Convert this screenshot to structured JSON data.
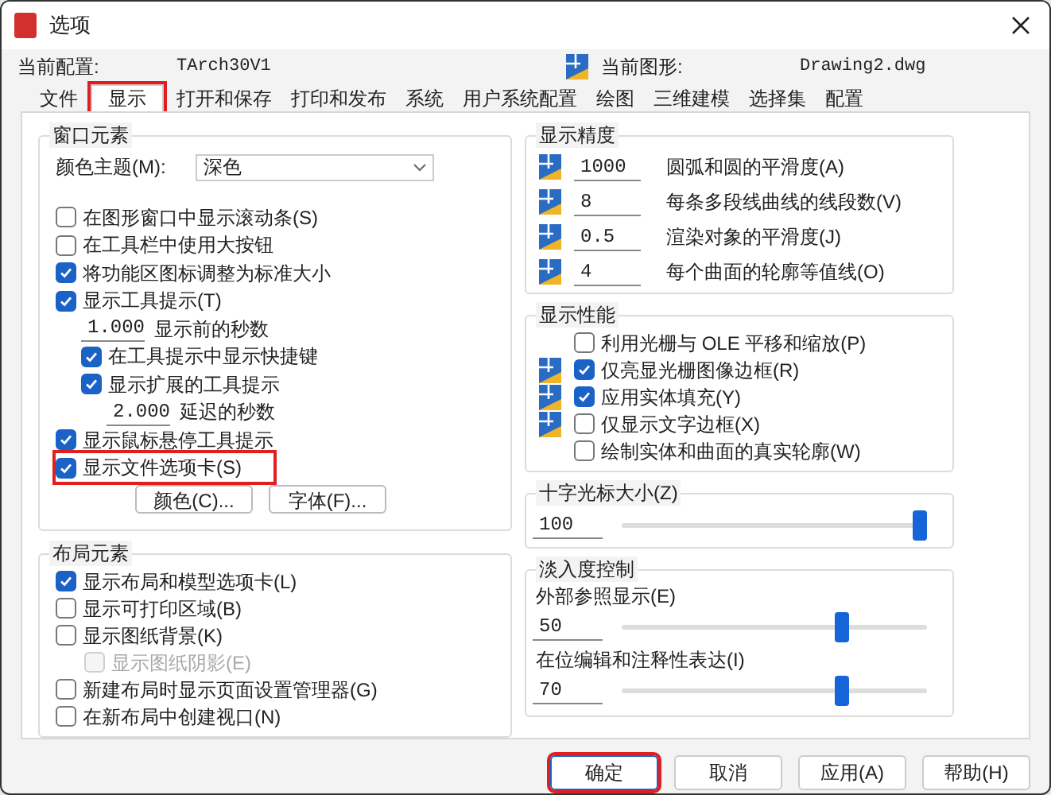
{
  "window": {
    "title": "选项"
  },
  "profile": {
    "label": "当前配置:",
    "value": "TArch30V1"
  },
  "drawing": {
    "label": "当前图形:",
    "value": "Drawing2.dwg"
  },
  "tabs": [
    {
      "label": "文件",
      "selected": false,
      "highlighted": false
    },
    {
      "label": "显示",
      "selected": true,
      "highlighted": true
    },
    {
      "label": "打开和保存",
      "selected": false,
      "highlighted": false
    },
    {
      "label": "打印和发布",
      "selected": false,
      "highlighted": false
    },
    {
      "label": "系统",
      "selected": false,
      "highlighted": false
    },
    {
      "label": "用户系统配置",
      "selected": false,
      "highlighted": false
    },
    {
      "label": "绘图",
      "selected": false,
      "highlighted": false
    },
    {
      "label": "三维建模",
      "selected": false,
      "highlighted": false
    },
    {
      "label": "选择集",
      "selected": false,
      "highlighted": false
    },
    {
      "label": "配置",
      "selected": false,
      "highlighted": false
    }
  ],
  "window_elements": {
    "title": "窗口元素",
    "color_theme": {
      "label": "颜色主题(M):",
      "value": "深色"
    },
    "items": [
      {
        "kind": "checkbox",
        "label": "在图形窗口中显示滚动条(S)",
        "checked": false,
        "highlighted": false
      },
      {
        "kind": "checkbox",
        "label": "在工具栏中使用大按钮",
        "checked": false,
        "highlighted": false
      },
      {
        "kind": "checkbox",
        "label": "将功能区图标调整为标准大小",
        "checked": true,
        "highlighted": false
      },
      {
        "kind": "checkbox",
        "label": "显示工具提示(T)",
        "checked": true,
        "highlighted": false,
        "children": [
          {
            "kind": "number",
            "value": "1.000",
            "label": "显示前的秒数"
          },
          {
            "kind": "checkbox",
            "label": "在工具提示中显示快捷键",
            "checked": true,
            "highlighted": false
          },
          {
            "kind": "checkbox",
            "label": "显示扩展的工具提示",
            "checked": true,
            "highlighted": false,
            "children": [
              {
                "kind": "number",
                "value": "2.000",
                "label": "延迟的秒数"
              }
            ]
          }
        ]
      },
      {
        "kind": "checkbox",
        "label": "显示鼠标悬停工具提示",
        "checked": true,
        "highlighted": false
      },
      {
        "kind": "checkbox",
        "label": "显示文件选项卡(S)",
        "checked": true,
        "highlighted": true
      }
    ],
    "buttons": [
      "颜色(C)...",
      "字体(F)..."
    ]
  },
  "layout_elements": {
    "title": "布局元素",
    "items": [
      {
        "label": "显示布局和模型选项卡(L)",
        "checked": true,
        "disabled": false
      },
      {
        "label": "显示可打印区域(B)",
        "checked": false,
        "disabled": false
      },
      {
        "label": "显示图纸背景(K)",
        "checked": false,
        "disabled": false,
        "children": [
          {
            "label": "显示图纸阴影(E)",
            "checked": false,
            "disabled": true
          }
        ]
      },
      {
        "label": "新建布局时显示页面设置管理器(G)",
        "checked": false,
        "disabled": false
      },
      {
        "label": "在新布局中创建视口(N)",
        "checked": false,
        "disabled": false
      }
    ]
  },
  "display_resolution": {
    "title": "显示精度",
    "rows": [
      {
        "value": "1000",
        "label": "圆弧和圆的平滑度(A)"
      },
      {
        "value": "8",
        "label": "每条多段线曲线的线段数(V)"
      },
      {
        "value": "0.5",
        "label": "渲染对象的平滑度(J)"
      },
      {
        "value": "4",
        "label": "每个曲面的轮廓等值线(O)"
      }
    ]
  },
  "display_performance": {
    "title": "显示性能",
    "items": [
      {
        "label": "利用光栅与 OLE 平移和缩放(P)",
        "checked": false,
        "saved_in_drawing": false
      },
      {
        "label": "仅亮显光栅图像边框(R)",
        "checked": true,
        "saved_in_drawing": true
      },
      {
        "label": "应用实体填充(Y)",
        "checked": true,
        "saved_in_drawing": true
      },
      {
        "label": "仅显示文字边框(X)",
        "checked": false,
        "saved_in_drawing": true
      },
      {
        "label": "绘制实体和曲面的真实轮廓(W)",
        "checked": false,
        "saved_in_drawing": false
      }
    ]
  },
  "crosshair_size": {
    "title": "十字光标大小(Z)",
    "value": "100",
    "level": 1.0
  },
  "fade_control": {
    "title": "淡入度控制",
    "rows": [
      {
        "label": "外部参照显示(E)",
        "value": "50",
        "level": 0.73
      },
      {
        "label": "在位编辑和注释性表达(I)",
        "value": "70",
        "level": 0.73
      }
    ]
  },
  "buttons": [
    {
      "label": "确定",
      "highlighted": true
    },
    {
      "label": "取消",
      "highlighted": false
    },
    {
      "label": "应用(A)",
      "highlighted": false
    },
    {
      "label": "帮助(H)",
      "highlighted": false
    }
  ]
}
